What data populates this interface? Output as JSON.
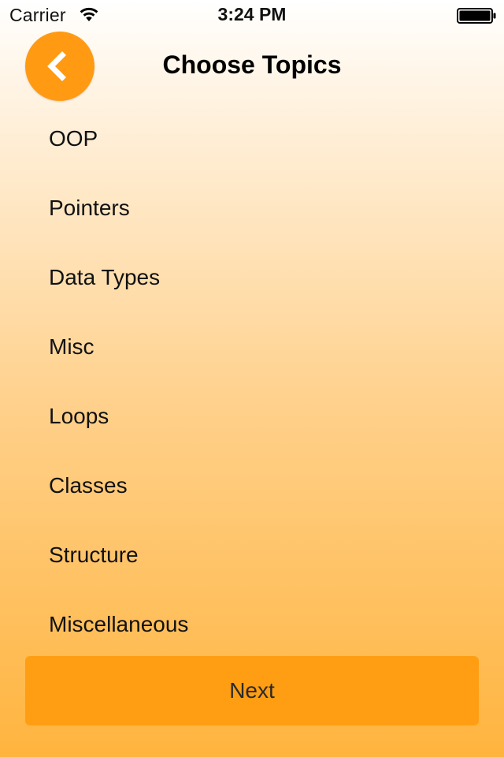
{
  "status_bar": {
    "carrier": "Carrier",
    "time": "3:24 PM",
    "icons": [
      "wifi-icon",
      "battery-icon"
    ]
  },
  "header": {
    "title": "Choose Topics",
    "back_icon": "chevron-left-icon"
  },
  "topics": [
    {
      "label": "OOP"
    },
    {
      "label": "Pointers"
    },
    {
      "label": "Data Types"
    },
    {
      "label": "Misc"
    },
    {
      "label": "Loops"
    },
    {
      "label": "Classes"
    },
    {
      "label": "Structure"
    },
    {
      "label": "Miscellaneous"
    }
  ],
  "footer": {
    "next_label": "Next"
  },
  "colors": {
    "accent": "#ff9a12",
    "gradient_top": "#ffffff",
    "gradient_bottom": "#ffb43e"
  }
}
